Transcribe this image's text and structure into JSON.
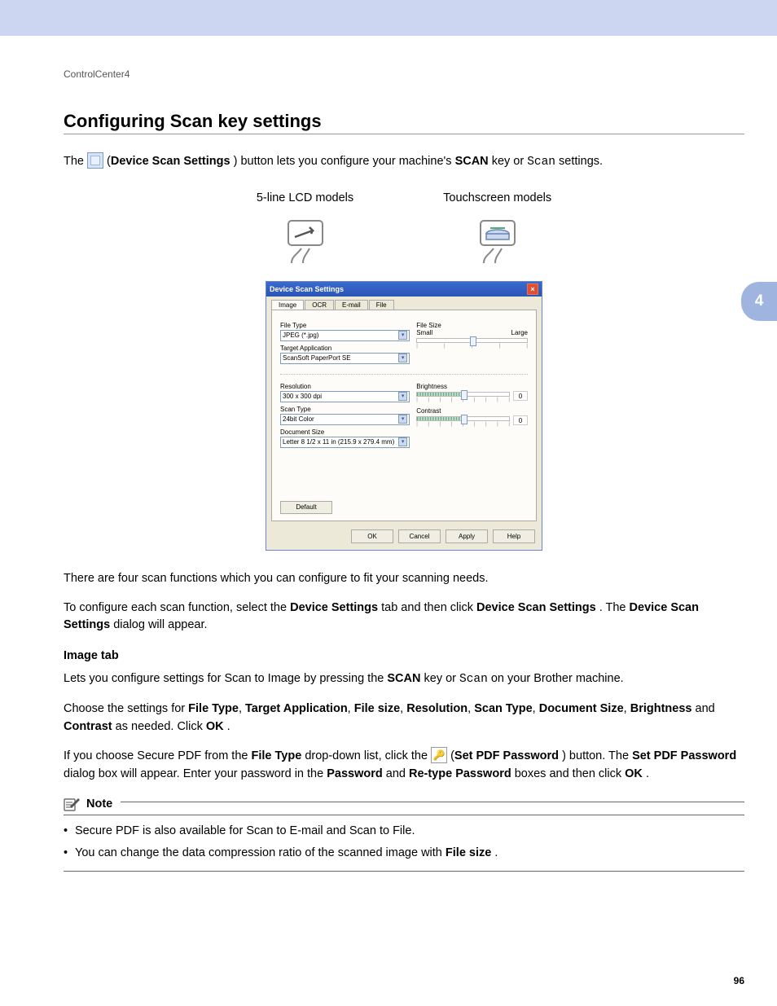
{
  "running_header": "ControlCenter4",
  "heading": "Configuring Scan key settings",
  "side_tab": "4",
  "intro": {
    "pre": "The ",
    "button_label": "Device Scan Settings",
    "mid": ") button lets you configure your machine's ",
    "scan_caps": "SCAN",
    "key_or": " key or ",
    "scan_mono": "Scan",
    "post": " settings."
  },
  "models": {
    "lcd": "5-line LCD models",
    "touch": "Touchscreen models"
  },
  "dialog": {
    "title": "Device Scan Settings",
    "tabs": [
      "Image",
      "OCR",
      "E-mail",
      "File"
    ],
    "active_tab": 0,
    "file_type": {
      "label": "File Type",
      "value": "JPEG (*.jpg)"
    },
    "target_app": {
      "label": "Target Application",
      "value": "ScanSoft PaperPort SE"
    },
    "resolution": {
      "label": "Resolution",
      "value": "300 x 300 dpi"
    },
    "scan_type": {
      "label": "Scan Type",
      "value": "24bit Color"
    },
    "doc_size": {
      "label": "Document Size",
      "value": "Letter 8 1/2 x 11 in (215.9 x 279.4 mm)"
    },
    "file_size": {
      "label": "File Size",
      "small": "Small",
      "large": "Large"
    },
    "brightness": {
      "label": "Brightness",
      "value": "0"
    },
    "contrast": {
      "label": "Contrast",
      "value": "0"
    },
    "default_btn": "Default",
    "footer": {
      "ok": "OK",
      "cancel": "Cancel",
      "apply": "Apply",
      "help": "Help"
    }
  },
  "para_four_functions": "There are four scan functions which you can configure to fit your scanning needs.",
  "para_configure": {
    "pre": "To configure each scan function, select the ",
    "b1": "Device Settings",
    "mid": " tab and then click ",
    "b2": "Device Scan Settings",
    "post": ". The ",
    "b3": "Device Scan Settings",
    "post2": " dialog will appear."
  },
  "subheading_image": "Image tab",
  "para_image1": {
    "pre": "Lets you configure settings for Scan to Image by pressing the ",
    "scan_caps": "SCAN",
    "mid": " key or ",
    "scan_mono": "Scan",
    "post": " on your Brother machine."
  },
  "para_image2": {
    "pre": "Choose the settings for ",
    "terms": [
      "File Type",
      "Target Application",
      "File size",
      "Resolution",
      "Scan Type",
      "Document Size",
      "Brightness",
      "Contrast"
    ],
    "sep": ", ",
    "and": " and ",
    "post": " as needed. Click ",
    "ok": "OK",
    "dot": "."
  },
  "para_secure": {
    "pre": "If you choose Secure PDF from the ",
    "ft": "File Type",
    "mid": " drop-down list, click the ",
    "btn": "Set PDF Password",
    "mid2": ") button. The ",
    "dlg": "Set PDF Password",
    "mid3": " dialog box will appear. Enter your password in the ",
    "pw": "Password",
    "and": " and ",
    "rpw": "Re-type Password",
    "mid4": " boxes and then click ",
    "ok": "OK",
    "dot": "."
  },
  "note": {
    "title": "Note",
    "items": [
      {
        "text_pre": "Secure PDF is also available for Scan to E-mail and Scan to File.",
        "bold": null
      },
      {
        "text_pre": "You can change the data compression ratio of the scanned image with ",
        "bold": "File size",
        "text_post": "."
      }
    ]
  },
  "page_number": "96"
}
